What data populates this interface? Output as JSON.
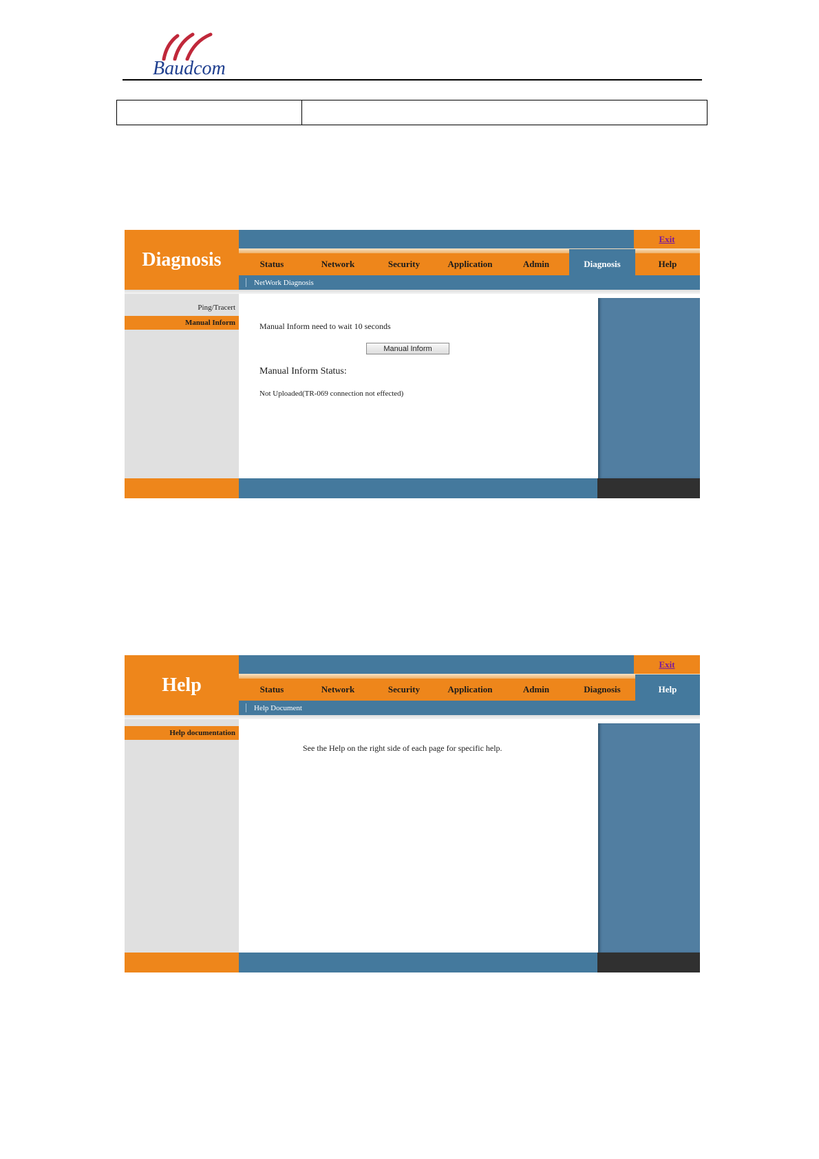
{
  "doc_header": {
    "logo_text": "Baudcom",
    "logo_colors": {
      "arcs": "#c0283a",
      "text": "#1f3f8f"
    }
  },
  "colors": {
    "orange": "#ee861b",
    "steel_blue": "#44799d",
    "right_column": "#517ea1",
    "sidebar": "#e0e0e0",
    "footer_dark": "#303030"
  },
  "diagnosis_panel": {
    "title": "Diagnosis",
    "exit_label": "Exit",
    "nav_tabs": [
      "Status",
      "Network",
      "Security",
      "Application",
      "Admin",
      "Diagnosis",
      "Help"
    ],
    "active_tab": "Diagnosis",
    "sub_nav": "NetWork Diagnosis",
    "sidebar_items": [
      {
        "label": "Ping/Tracert",
        "active": false
      },
      {
        "label": "Manual Inform",
        "active": true
      }
    ],
    "content": {
      "wait_text": "Manual Inform need to wait 10 seconds",
      "button_label": "Manual Inform",
      "status_heading": "Manual Inform Status:",
      "status_text": "Not Uploaded(TR-069 connection not effected)"
    }
  },
  "help_panel": {
    "title": "Help",
    "exit_label": "Exit",
    "nav_tabs": [
      "Status",
      "Network",
      "Security",
      "Application",
      "Admin",
      "Diagnosis",
      "Help"
    ],
    "active_tab": "Help",
    "sub_nav": "Help Document",
    "sidebar_items": [
      {
        "label": "Help documentation",
        "active": true
      }
    ],
    "content": {
      "help_text": "See the Help on the right side of each page for specific help."
    }
  }
}
